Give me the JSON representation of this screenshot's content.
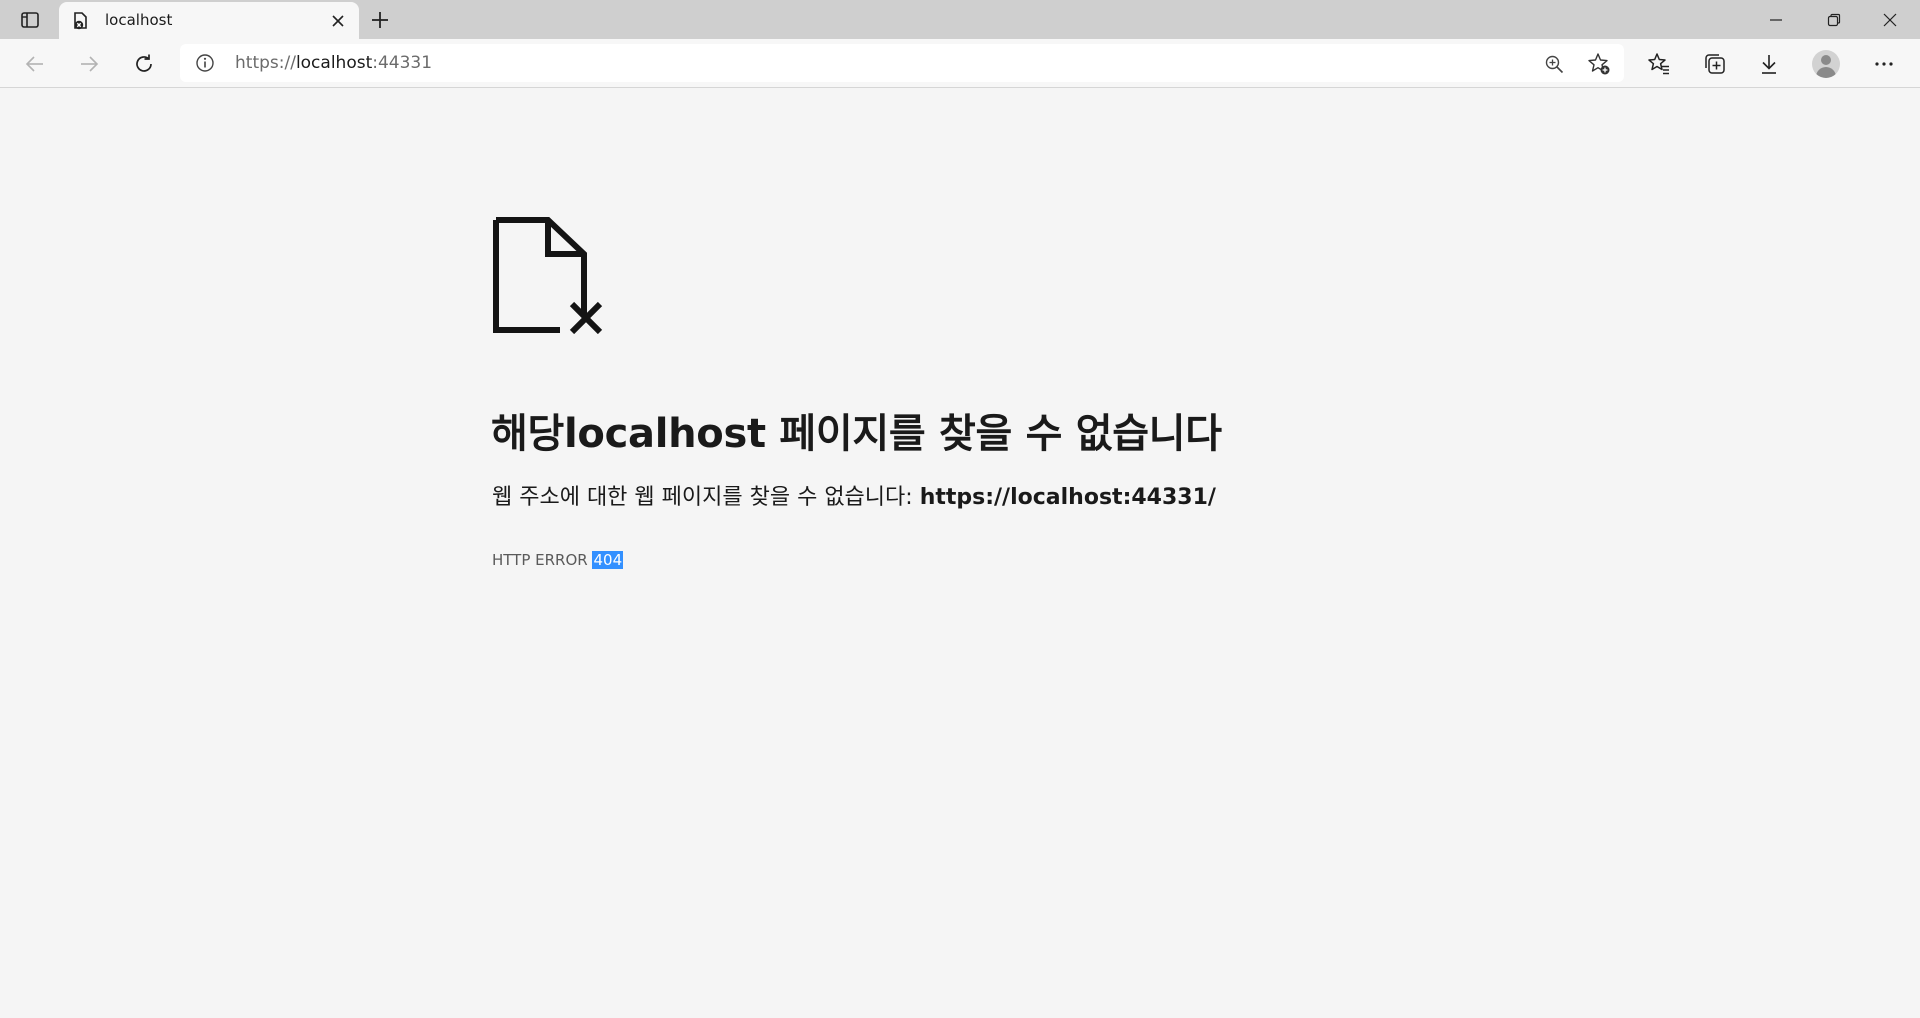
{
  "browser": {
    "tab": {
      "title": "localhost",
      "favicon": "file-error-icon"
    },
    "address_bar": {
      "scheme": "https://",
      "host": "localhost",
      "port": ":44331"
    },
    "colors": {
      "tabstrip": "#cfcfcf",
      "toolbar": "#f7f7f7",
      "page_background": "#f5f5f5",
      "selection": "#3390ff"
    }
  },
  "page": {
    "icon": "page-not-found-icon",
    "heading": "해당localhost 페이지를 찾을 수 없습니다",
    "message": "웹 주소에 대한 웹 페이지를 찾을 수 없습니다: ",
    "message_url": "https://localhost:44331/",
    "error_label": "HTTP ERROR ",
    "error_code": "404"
  }
}
